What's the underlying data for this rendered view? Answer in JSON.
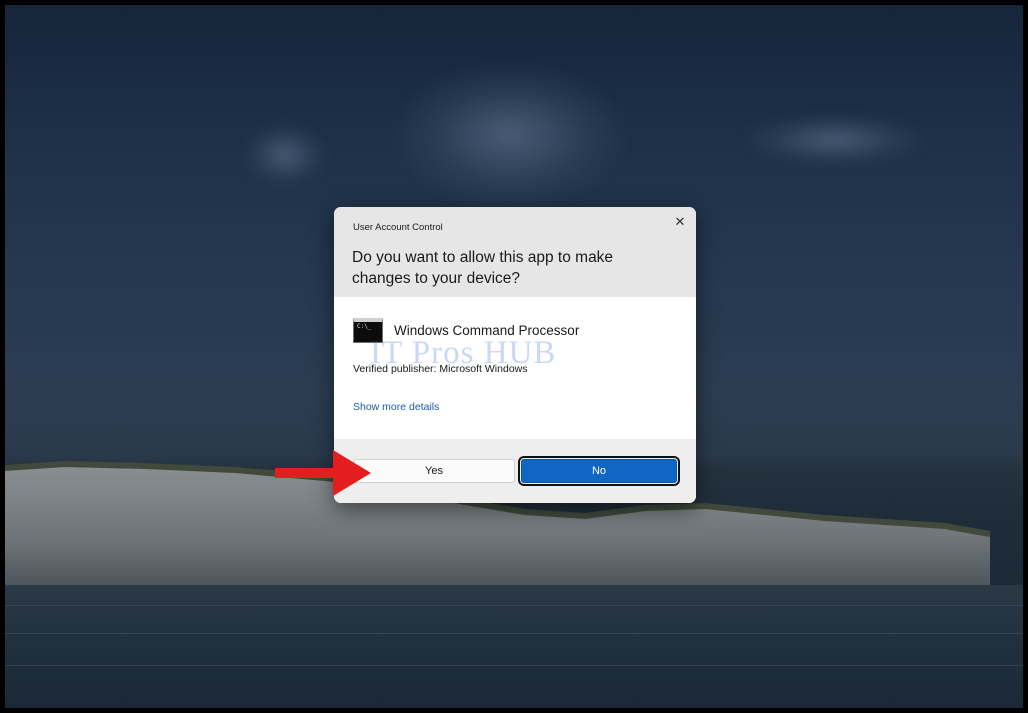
{
  "dialog": {
    "caption": "User Account Control",
    "close_glyph": "✕",
    "question": "Do you want to allow this app to make changes to your device?",
    "app_name": "Windows Command Processor",
    "app_icon": "command-prompt-icon",
    "app_icon_text": "C:\\_",
    "publisher": "Verified publisher: Microsoft Windows",
    "more_details": "Show more details",
    "yes_label": "Yes",
    "no_label": "No"
  },
  "watermark": "IT Pros HUB",
  "annotation": {
    "arrow_icon": "red-arrow-icon",
    "arrow_color": "#e41e1e"
  },
  "colors": {
    "primary_button": "#0f66c4",
    "link": "#1a5ea8",
    "header_bg": "#e6e6e6"
  }
}
